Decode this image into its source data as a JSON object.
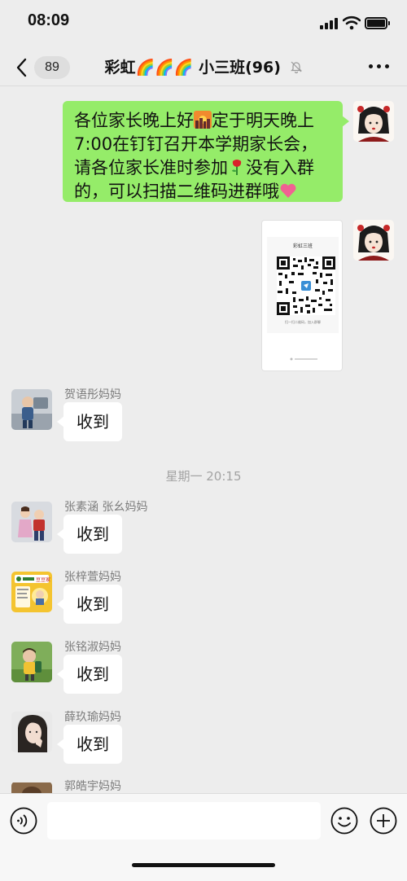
{
  "status_bar": {
    "time": "08:09"
  },
  "header": {
    "back_count": "89",
    "title": "彩虹🌈🌈🌈 小三班(96)"
  },
  "messages": {
    "outgoing_text_parts": [
      "各位家长晚上好",
      "定于明天晚上7:00在钉钉召开本学期家长会，请各位家长准时参加",
      "没有入群的，可以扫描二维码进群哦"
    ],
    "qr_card": {
      "group_name": "彩虹三班",
      "note": "扫一扫二维码，加入群聊"
    },
    "timestamp": "星期一 20:15",
    "incoming": [
      {
        "sender": "贺语彤妈妈",
        "text": "收到"
      },
      {
        "sender": "张素涵 张幺妈妈",
        "text": "收到"
      },
      {
        "sender": "张梓萱妈妈",
        "text": "收到"
      },
      {
        "sender": "张铭淑妈妈",
        "text": "收到"
      },
      {
        "sender": "薛玖瑜妈妈",
        "text": "收到"
      },
      {
        "sender": "郭皓宇妈妈",
        "text": ""
      }
    ],
    "avatar_sticker_text": "豆豆家"
  },
  "input_bar": {
    "placeholder": ""
  },
  "colors": {
    "chat_bg": "#ededed",
    "outgoing_bubble": "#95ec69",
    "incoming_bubble": "#ffffff",
    "sender_name": "#7d7d7d"
  },
  "icons": [
    "back-icon",
    "mute-icon",
    "more-icon",
    "voice-icon",
    "emoji-icon",
    "plus-icon"
  ]
}
